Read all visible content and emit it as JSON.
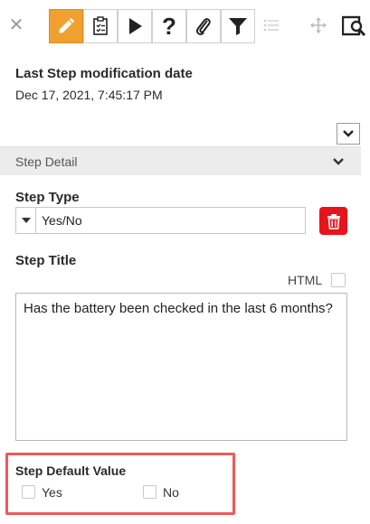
{
  "toolbar": {
    "close_icon": "close-icon",
    "buttons": [
      "pencil-icon",
      "checklist-icon",
      "play-icon",
      "help-icon",
      "paperclip-icon",
      "filter-icon"
    ],
    "disabled": [
      "list-icon",
      "move-icon"
    ],
    "right_icon": "search-panel-icon"
  },
  "last_modified": {
    "label": "Last Step modification date",
    "value": "Dec 17, 2021, 7:45:17 PM"
  },
  "step_detail": {
    "header": "Step Detail",
    "step_type_label": "Step Type",
    "step_type_value": "Yes/No",
    "step_title_label": "Step Title",
    "html_label": "HTML",
    "html_checked": false,
    "step_title_value": "Has the battery been checked in the last 6 months?",
    "default_value_label": "Step Default Value",
    "options": [
      {
        "label": "Yes",
        "checked": false
      },
      {
        "label": "No",
        "checked": false
      }
    ]
  },
  "colors": {
    "active_tool": "#f0a030",
    "delete": "#e8141b",
    "highlight": "#ee5a5a",
    "header_bg": "#ececec"
  }
}
